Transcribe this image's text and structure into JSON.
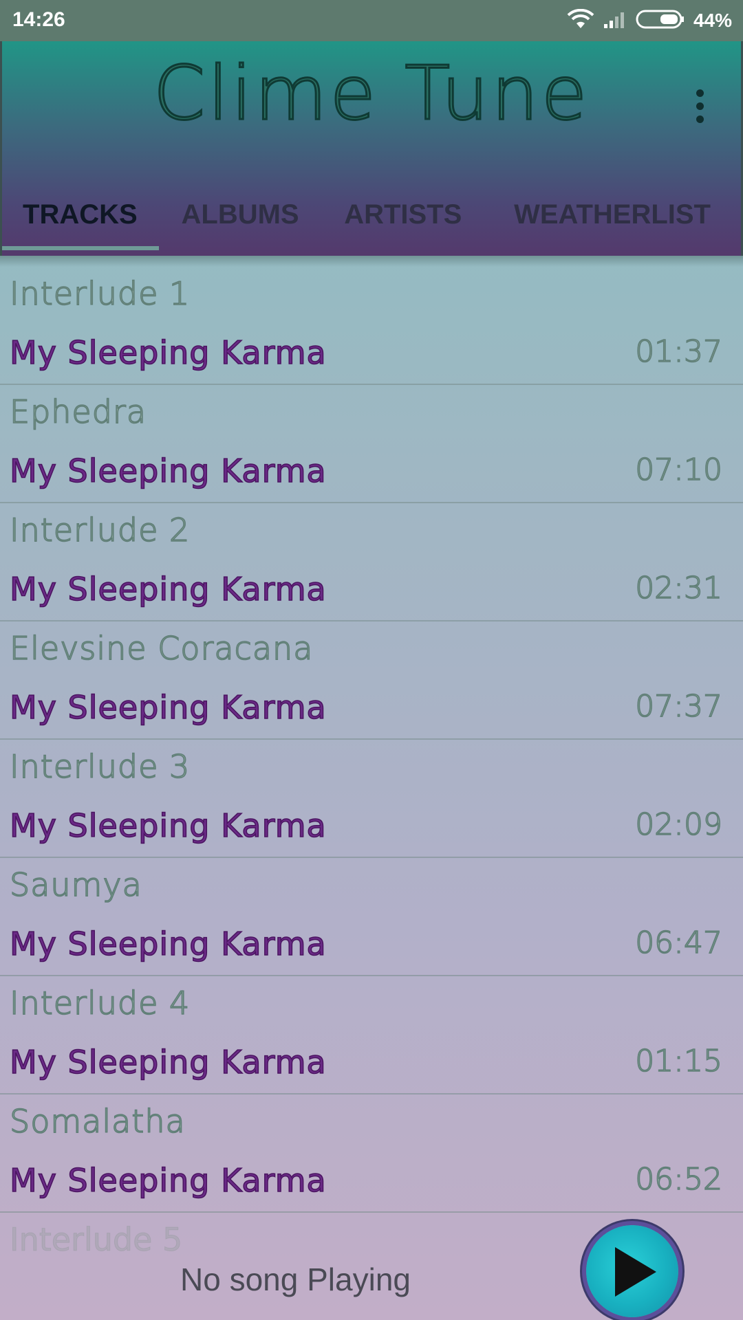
{
  "status_bar": {
    "time": "14:26",
    "battery_percent": "44%",
    "icons": [
      "wifi-icon",
      "signal-icon",
      "battery-icon"
    ]
  },
  "app": {
    "title": "Clime Tune",
    "menu_icon": "more-vert-icon"
  },
  "tabs": [
    {
      "label": "TRACKS",
      "active": true
    },
    {
      "label": "ALBUMS",
      "active": false
    },
    {
      "label": "ARTISTS",
      "active": false
    },
    {
      "label": "WEATHERLIST",
      "active": false
    }
  ],
  "tracks": [
    {
      "title": "Interlude 1",
      "artist": "My Sleeping Karma",
      "duration": "01:37"
    },
    {
      "title": "Ephedra",
      "artist": "My Sleeping Karma",
      "duration": "07:10"
    },
    {
      "title": "Interlude 2",
      "artist": "My Sleeping Karma",
      "duration": "02:31"
    },
    {
      "title": "Elevsine Coracana",
      "artist": "My Sleeping Karma",
      "duration": "07:37"
    },
    {
      "title": "Interlude 3",
      "artist": "My Sleeping Karma",
      "duration": "02:09"
    },
    {
      "title": "Saumya",
      "artist": "My Sleeping Karma",
      "duration": "06:47"
    },
    {
      "title": "Interlude 4",
      "artist": "My Sleeping Karma",
      "duration": "01:15"
    },
    {
      "title": "Somalatha",
      "artist": "My Sleeping Karma",
      "duration": "06:52"
    }
  ],
  "faded_next_title": "Interlude 5",
  "player": {
    "now_playing": "No song Playing",
    "play_icon": "play-icon"
  },
  "colors": {
    "status_bar": "#5e7a6e",
    "header_top": "#219586",
    "header_bottom": "#54396c",
    "artist_text": "#6a2a86",
    "play_button": "#18b0c0"
  }
}
